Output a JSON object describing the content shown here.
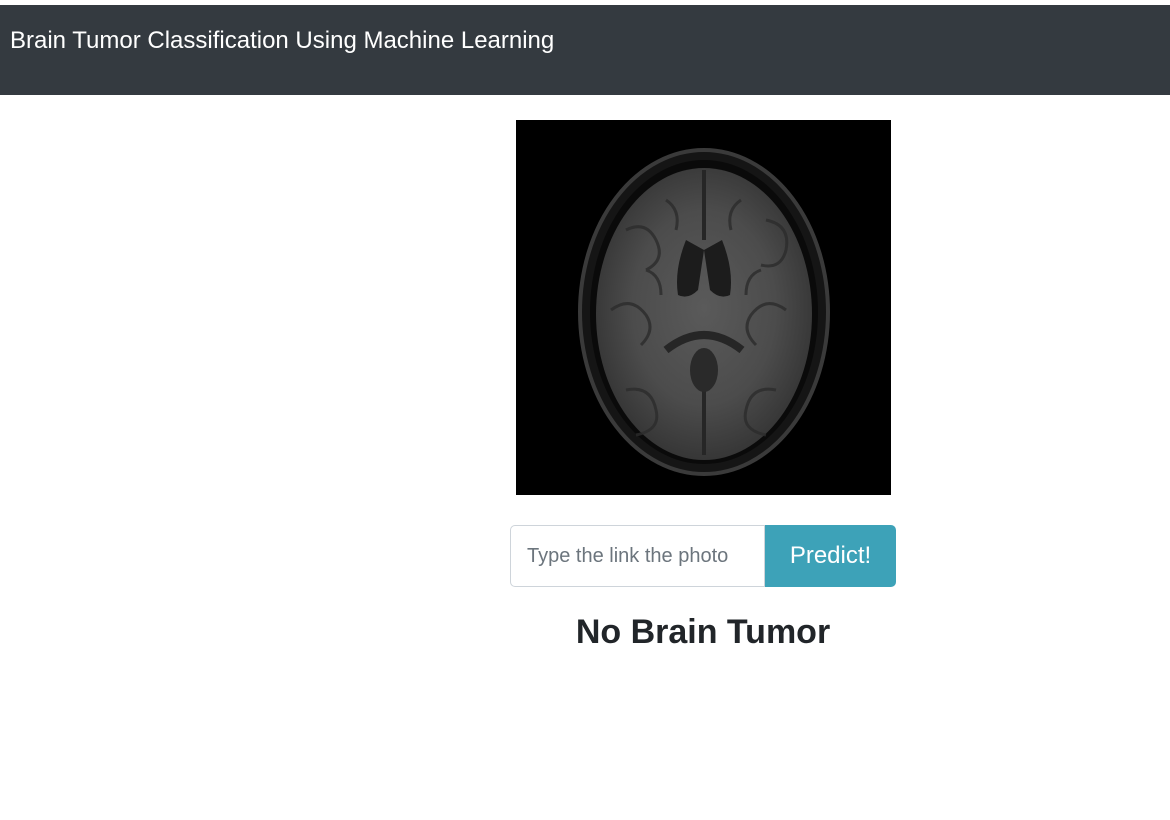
{
  "navbar": {
    "title": "Brain Tumor Classification Using Machine Learning"
  },
  "scan": {
    "description_icon": "brain-mri-image"
  },
  "form": {
    "url_placeholder": "Type the link the photo",
    "url_value": "",
    "predict_label": "Predict!"
  },
  "result": {
    "text": "No Brain Tumor"
  },
  "colors": {
    "navbar_bg": "#343a40",
    "button_bg": "#3da2b8",
    "result_text": "#212529"
  }
}
